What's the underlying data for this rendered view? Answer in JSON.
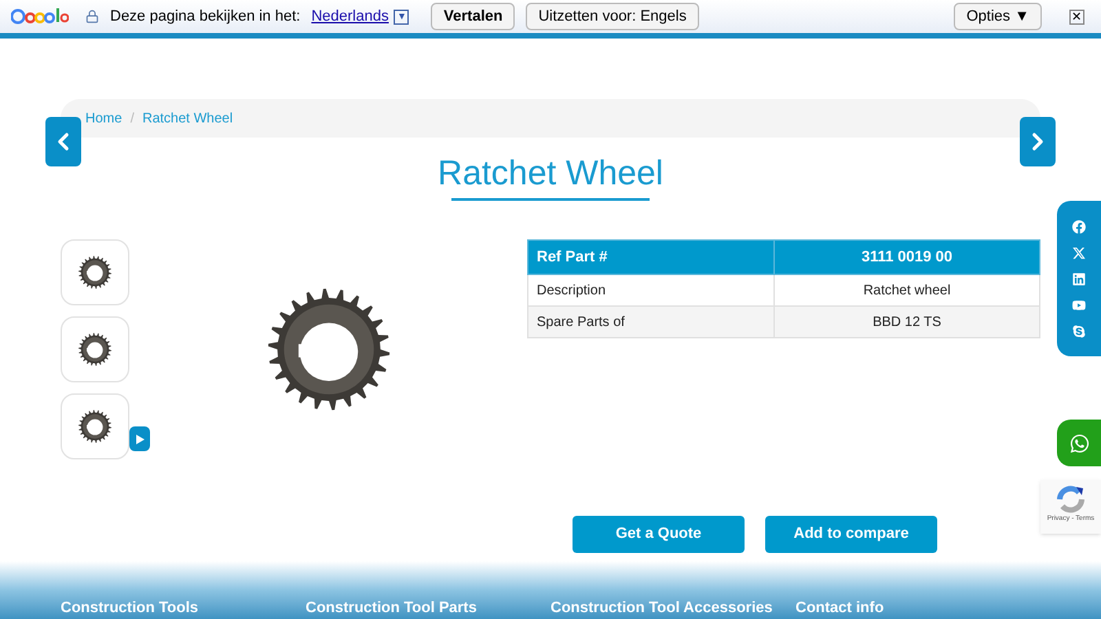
{
  "translate_bar": {
    "prompt": "Deze pagina bekijken in het:",
    "language": "Nederlands",
    "dropdown_glyph": "▼",
    "translate_button": "Vertalen",
    "turn_off_button": "Uitzetten voor: Engels",
    "options_button": "Opties ▼",
    "close_glyph": "✕"
  },
  "breadcrumb": [
    {
      "label": "Home"
    },
    {
      "label": "Ratchet Wheel"
    }
  ],
  "breadcrumb_separator": "/",
  "title": "Ratchet Wheel",
  "thumbnails": [
    {
      "selected": false
    },
    {
      "selected": false
    },
    {
      "selected": false
    }
  ],
  "spec_table": {
    "header": [
      "Ref Part #",
      "3111 0019 00"
    ],
    "rows": [
      [
        "Description",
        "Ratchet wheel"
      ],
      [
        "Spare Parts of",
        "BBD 12 TS"
      ]
    ]
  },
  "actions": [
    "Get a Quote",
    "Add to compare"
  ],
  "recaptcha": {
    "links": "Privacy - Terms"
  },
  "footer": {
    "headings": [
      "Construction Tools",
      "Construction Tool Parts",
      "Construction Tool Accessories",
      "Contact info"
    ]
  }
}
